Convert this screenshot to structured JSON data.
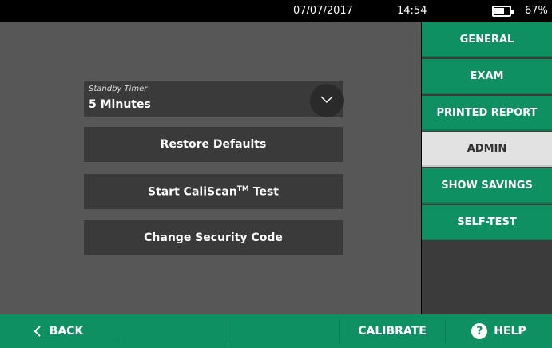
{
  "status": {
    "date": "07/07/2017",
    "time": "14:54",
    "battery_percent": 67,
    "battery_label": "67%"
  },
  "settings": {
    "standby_label": "Standby Timer",
    "standby_value": "5 Minutes",
    "restore_label": "Restore Defaults",
    "caliscan_label": "Start CaliScan",
    "caliscan_tm": "TM",
    "caliscan_suffix": " Test",
    "security_label": "Change Security Code"
  },
  "tabs": [
    {
      "label": "GENERAL"
    },
    {
      "label": "EXAM"
    },
    {
      "label": "PRINTED REPORT"
    },
    {
      "label": "ADMIN",
      "active": true
    },
    {
      "label": "SHOW SAVINGS"
    },
    {
      "label": "SELF-TEST"
    }
  ],
  "bottom": {
    "back_label": "BACK",
    "calibrate_label": "CALIBRATE",
    "help_label": "HELP"
  },
  "icons": {
    "battery": "battery-icon",
    "chevron": "chevron-down-icon",
    "back": "chevron-left-icon",
    "help": "help-icon"
  },
  "colors": {
    "accent": "#0f9063",
    "panel": "#575757",
    "button": "#3a3a3a",
    "active_tab": "#e2e2e2"
  }
}
